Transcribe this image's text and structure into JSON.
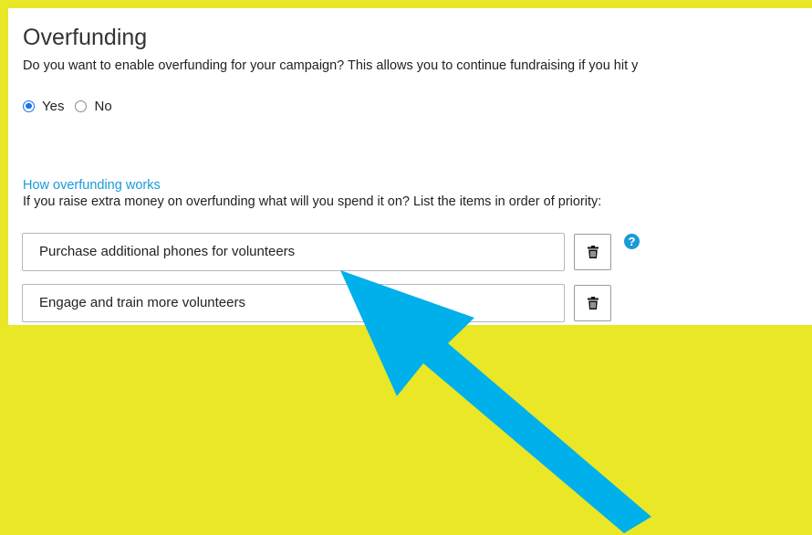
{
  "overfunding": {
    "title": "Overfunding",
    "question": "Do you want to enable overfunding for your campaign? This allows you to continue fundraising if you hit y",
    "options": [
      {
        "label": "Yes",
        "checked": true
      },
      {
        "label": "No",
        "checked": false
      }
    ],
    "how_link": "How overfunding works",
    "instructions": "If you raise extra money on overfunding what will you spend it on? List the items in order of priority:",
    "items": [
      "Purchase additional phones for volunteers",
      "Engage and train more volunteers"
    ],
    "help_glyph": "?",
    "delete_icon": "trash-icon"
  },
  "colors": {
    "background": "#e9e726",
    "link": "#1a9bd7",
    "arrow": "#00b0ea"
  }
}
